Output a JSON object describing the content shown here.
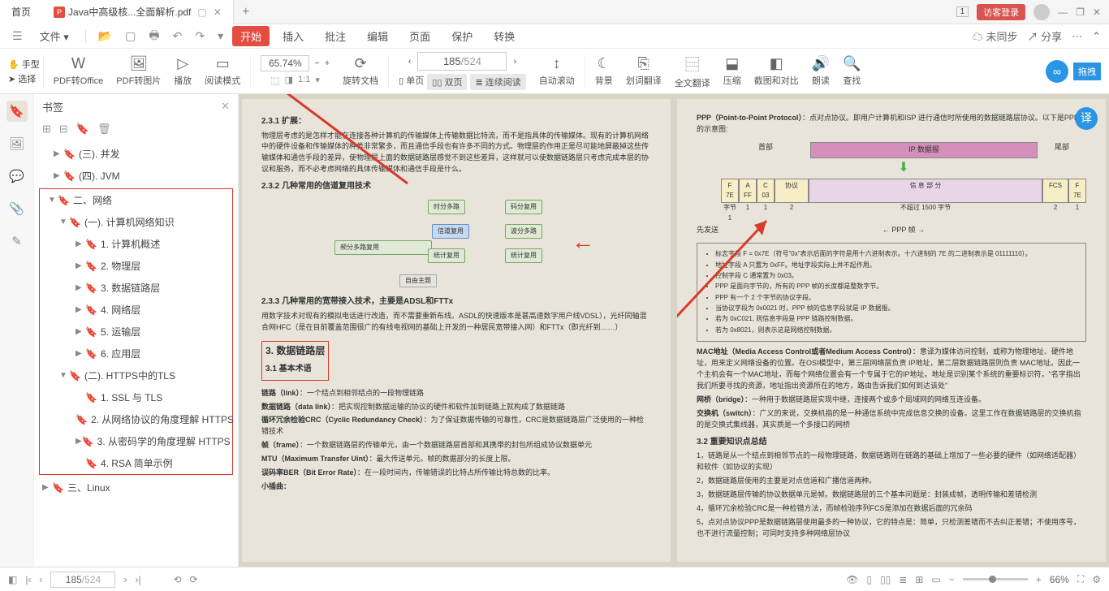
{
  "titlebar": {
    "home": "首页",
    "filename": "Java中高级核...全面解析.pdf",
    "login": "访客登录",
    "badge": "1"
  },
  "menubar": {
    "file": "文件",
    "items": [
      "开始",
      "插入",
      "批注",
      "编辑",
      "页面",
      "保护",
      "转换"
    ],
    "unsync": "未同步",
    "share": "分享"
  },
  "ribbon": {
    "hand": "手型",
    "select": "选择",
    "pdf2office": "PDF转Office",
    "pdf2img": "PDF转图片",
    "play": "播放",
    "readmode": "阅读模式",
    "zoom": "65.74%",
    "rotate": "旋转文档",
    "page_current": "185",
    "page_total": "/524",
    "single": "单页",
    "double": "双页",
    "continuous": "连续阅读",
    "autoscroll": "自动滚动",
    "bg": "背景",
    "seltrans": "划词翻译",
    "fulltrans": "全文翻译",
    "compress": "压缩",
    "crop": "截图和对比",
    "read": "朗读",
    "find": "查找",
    "drag": "拖拽"
  },
  "rail": {
    "bookmark": "bookmark",
    "thumb": "thumb",
    "comment": "comment",
    "attach": "attach",
    "layer": "layer"
  },
  "bookmarks": {
    "title": "书签",
    "items": [
      {
        "lvl": 1,
        "caret": "▶",
        "label": "(三). 并发"
      },
      {
        "lvl": 1,
        "caret": "▶",
        "label": "(四). JVM"
      },
      {
        "lvl": 0,
        "caret": "▼",
        "label": "二、网络",
        "boxstart": true
      },
      {
        "lvl": 1,
        "caret": "▼",
        "label": "(一). 计算机网络知识"
      },
      {
        "lvl": 2,
        "caret": "▶",
        "label": "1. 计算机概述"
      },
      {
        "lvl": 2,
        "caret": "▶",
        "label": "2. 物理层"
      },
      {
        "lvl": 2,
        "caret": "▶",
        "label": "3. 数据链路层"
      },
      {
        "lvl": 2,
        "caret": "▶",
        "label": "4. 网络层"
      },
      {
        "lvl": 2,
        "caret": "▶",
        "label": "5. 运输层"
      },
      {
        "lvl": 2,
        "caret": "▶",
        "label": "6. 应用层"
      },
      {
        "lvl": 1,
        "caret": "▼",
        "label": "(二). HTTPS中的TLS"
      },
      {
        "lvl": 2,
        "caret": "",
        "label": "1. SSL 与 TLS"
      },
      {
        "lvl": 2,
        "caret": "",
        "label": "2. 从网络协议的角度理解 HTTPS"
      },
      {
        "lvl": 2,
        "caret": "▶",
        "label": "3. 从密码学的角度理解 HTTPS"
      },
      {
        "lvl": 2,
        "caret": "",
        "label": "4. RSA 简单示例",
        "boxend": true
      },
      {
        "lvl": 0,
        "caret": "▶",
        "label": "三、Linux"
      }
    ]
  },
  "pageL": {
    "h1": "2.3.1 扩展：",
    "p1": "物理层考虑的是怎样才能在连接各种计算机的传输媒体上传输数据比特流，而不是指具体的传输媒体。现有的计算机网络中的硬件设备和传输媒体的种类非常繁多，而且通信手段也有许多不同的方式。物理层的作用正是尽可能地屏蔽掉这些传输媒体和通信手段的差异，使物理层上面的数据链路层感觉不到这些差异，这样就可以使数据链路层只考虑完成本层的协议和服务，而不必考虑网络的具体传输媒体和通信手段是什么。",
    "h2": "2.3.2 几种常用的信道复用技术",
    "diagram": {
      "center": "信道复用",
      "n1": "频分多路复用",
      "n2": "时分多路",
      "n3": "统计复用",
      "n4": "码分复用",
      "n5": "波分多路"
    },
    "free": "自由主题",
    "h3": "2.3.3 几种常用的宽带接入技术，主要是ADSL和FTTx",
    "p2": "用数字技术对现有的模拟电话进行改造，而不需要重新布线。ASDL的快速版本是甚高速数字用户线VDSL），光纤同轴混合网HFC（是在目前覆盖范围很广的有线电视网的基础上开发的一种居民宽带接入网）和FTTx（即光纤到……）",
    "sect1": "3. 数据链路层",
    "sect2": "3.1 基本术语",
    "t1": "链路（link）",
    "d1": "：一个结点到相邻结点的一段物理链路",
    "t2": "数据链路（data link）",
    "d2": "：把实现控制数据运输的协议的硬件和软件加到链路上就构成了数据链路",
    "t3": "循环冗余检验CRC（Cyclic Redundancy Check）",
    "d3": "：为了保证数据传输的可靠性，CRC是数据链路层广泛使用的一种检错技术",
    "t4": "帧（frame）",
    "d4": "：一个数据链路层的传输单元，由一个数据链路层首部和其携带的封包所组成协议数据单元",
    "t5": "MTU（Maximum Transfer Uint）",
    "d5": "：最大传送单元。帧的数据部分的长度上限。",
    "t6": "误码率BER（Bit Error Rate）",
    "d6": "：在一段时间内，传输错误的比特占所传输比特总数的比率。",
    "t7": "小插曲："
  },
  "pageR": {
    "h1": "PPP（Point-to-Point Protocol）",
    "p1": "：点对点协议。即用户计算机和ISP 进行通信时所使用的数据链路层协议。以下是PPP帧的示意图:",
    "frame": {
      "send": "先发送",
      "head": "首部",
      "ip": "IP 数据报",
      "tail": "尾部",
      "c": [
        "F 7E",
        "A FF",
        "C 03",
        "协议",
        "信 息 部 分",
        "FCS",
        "F 7E"
      ],
      "b": [
        "字节 1",
        "1",
        "1",
        "2",
        "不超过 1500 字节",
        "2",
        "1"
      ],
      "label": "PPP 帧"
    },
    "bullets": [
      "标志字段 F = 0x7E（符号\"0x\"表示后面的字符是用十六进制表示。十六进制的 7E 的二进制表示是 01111110）。",
      "地址字段 A 只置为 0xFF。地址字段实际上并不起作用。",
      "控制字段 C 通常置为 0x03。",
      "PPP 是面向字节的，所有的 PPP 帧的长度都是整数字节。",
      "PPP 有一个 2 个字节的协议字段。",
      "当协议字段为 0x0021 时，PPP 帧的信息字段就是 IP 数据报。",
      "若为 0xC021, 则信息字段是 PPP 链路控制数据。",
      "若为 0x8021，则表示这是网络控制数据。"
    ],
    "mac_t": "MAC地址（Media Access Control或者Medium Access Control）",
    "mac_d": "：意译为媒体访问控制，或称为物理地址、硬件地址，用来定义网络设备的位置。在OSI模型中，第三层网络层负责 IP地址，第二层数据链路层则负责 MAC地址。因此一个主机会有一个MAC地址，而每个网络位置会有一个专属于它的IP地址。地址是识别某个系统的重要标识符，\"名字指出我们所要寻找的资源，地址指出资源所在的地方，路由告诉我们如何到达该处\"",
    "bridge_t": "网桥（bridge）",
    "bridge_d": "：一种用于数据链路层实现中继，连接两个或多个局域网的网络互连设备。",
    "switch_t": "交换机（switch）",
    "switch_d": "：广义的来说，交换机指的是一种通信系统中完成信息交换的设备。这里工作在数据链路层的交换机指的是交换式集线器，其实质是一个多接口的网桥",
    "h2": "3.2 重要知识点总结",
    "li1": "1，链路是从一个结点到相邻节点的一段物理链路，数据链路则在链路的基础上增加了一些必要的硬件（如网络适配器）和软件（如协议的实现）",
    "li2": "2，数据链路层使用的主要是对点信道和广播信道两种。",
    "li3": "3，数据链路层传输的协议数据单元是帧。数据链路层的三个基本问题是：封装成帧，透明传输和差错检测",
    "li4": "4，循环冗余检验CRC是一种检错方法，而帧检验序列FCS是添加在数据后面的冗余码",
    "li5": "5，点对点协议PPP是数据链路层使用最多的一种协议，它的特点是：简单，只检测差错而不去纠正差错；不使用序号，也不进行流量控制；可同时支持多种网络层协议"
  },
  "status": {
    "page_cur": "185",
    "page_tot": "/524",
    "zoom": "66%"
  }
}
